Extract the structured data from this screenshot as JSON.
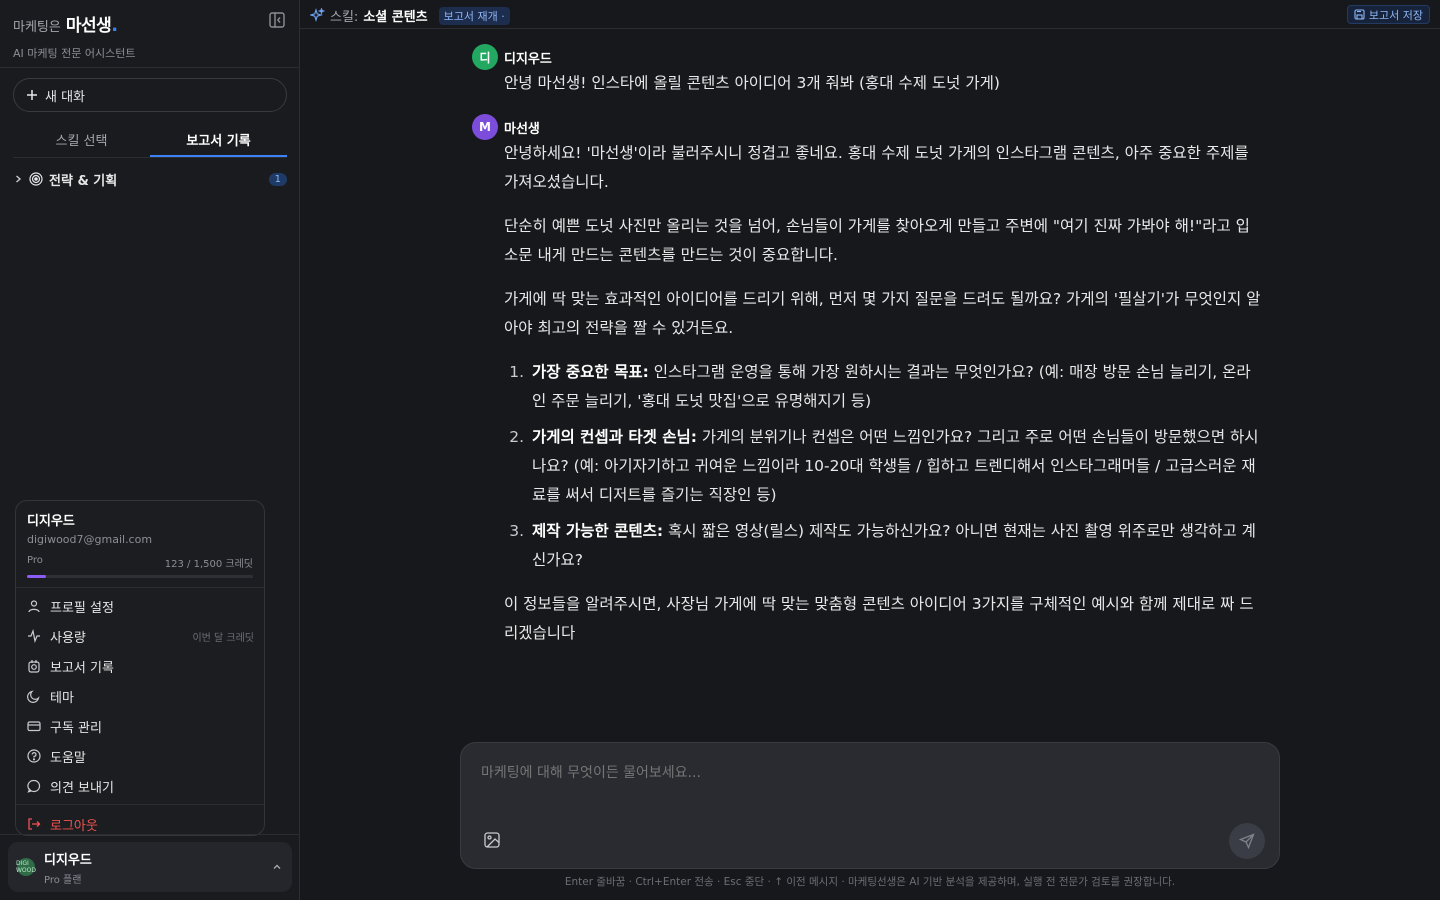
{
  "brand": {
    "small": "마케팅은",
    "big": "마선생",
    "dot": ".",
    "subtitle": "AI 마케팅 전문 어시스턴트"
  },
  "sidebar": {
    "new_chat": "새 대화",
    "tabs": [
      {
        "label": "스킬 선택"
      },
      {
        "label": "보고서 기록"
      }
    ],
    "category": {
      "label": "전략 & 기획",
      "count": "1"
    }
  },
  "user_menu": {
    "name": "디지우드",
    "email": "digiwood7@gmail.com",
    "plan": "Pro",
    "credits": "123 / 1,500 크레딧",
    "credit_fraction": 0.082,
    "items": [
      {
        "label": "프로필 설정",
        "icon": "user-icon"
      },
      {
        "label": "사용량",
        "icon": "activity-icon",
        "hint": "이번 달 크레딧"
      },
      {
        "label": "보고서 기록",
        "icon": "report-icon"
      },
      {
        "label": "테마",
        "icon": "moon-icon"
      },
      {
        "label": "구독 관리",
        "icon": "credit-card-icon"
      },
      {
        "label": "도움말",
        "icon": "help-icon"
      },
      {
        "label": "의견 보내기",
        "icon": "message-icon"
      }
    ],
    "logout": "로그아웃"
  },
  "footer_user": {
    "name": "디지우드",
    "plan": "Pro 플랜",
    "avatar_text": "DIGI WOOD"
  },
  "topbar": {
    "skill_prefix": "스킬:",
    "skill_name": "소셜 콘텐츠",
    "badge": "보고서 재개 ·",
    "save_label": "보고서 저장"
  },
  "chat": {
    "user": {
      "avatar": "디",
      "name": "디지우드",
      "text": "안녕 마선생! 인스타에 올릴 콘텐츠 아이디어 3개 줘봐 (홍대 수제 도넛 가게)"
    },
    "assistant": {
      "avatar": "M",
      "name": "마선생",
      "p1": "안녕하세요! '마선생'이라 불러주시니 정겹고 좋네요. 홍대 수제 도넛 가게의 인스타그램 콘텐츠, 아주 중요한 주제를 가져오셨습니다.",
      "p2": "단순히 예쁜 도넛 사진만 올리는 것을 넘어, 손님들이 가게를 찾아오게 만들고 주변에 \"여기 진짜 가봐야 해!\"라고 입소문 내게 만드는 콘텐츠를 만드는 것이 중요합니다.",
      "p3": "가게에 딱 맞는 효과적인 아이디어를 드리기 위해, 먼저 몇 가지 질문을 드려도 될까요? 가게의 '필살기'가 무엇인지 알아야 최고의 전략을 짤 수 있거든요.",
      "list": [
        {
          "num": "1.",
          "title": "가장 중요한 목표:",
          "text": " 인스타그램 운영을 통해 가장 원하시는 결과는 무엇인가요? (예: 매장 방문 손님 늘리기, 온라인 주문 늘리기, '홍대 도넛 맛집'으로 유명해지기 등)"
        },
        {
          "num": "2.",
          "title": "가게의 컨셉과 타겟 손님:",
          "text": " 가게의 분위기나 컨셉은 어떤 느낌인가요? 그리고 주로 어떤 손님들이 방문했으면 하시나요? (예: 아기자기하고 귀여운 느낌이라 10-20대 학생들 / 힙하고 트렌디해서 인스타그래머들 / 고급스러운 재료를 써서 디저트를 즐기는 직장인 등)"
        },
        {
          "num": "3.",
          "title": "제작 가능한 콘텐츠:",
          "text": " 혹시 짧은 영상(릴스) 제작도 가능하신가요? 아니면 현재는 사진 촬영 위주로만 생각하고 계신가요?"
        }
      ],
      "p4": "이 정보들을 알려주시면, 사장님 가게에 딱 맞는 맞춤형 콘텐츠 아이디어 3가지를 구체적인 예시와 함께 제대로 짜 드리겠습니다"
    }
  },
  "composer": {
    "placeholder": "마케팅에 대해 무엇이든 물어보세요...",
    "hint": "Enter 줄바꿈 · Ctrl+Enter 전송 · Esc 중단 · ↑ 이전 메시지 · 마케팅선생은 AI 기반 분석을 제공하며, 실행 전 전문가 검토를 권장합니다."
  }
}
